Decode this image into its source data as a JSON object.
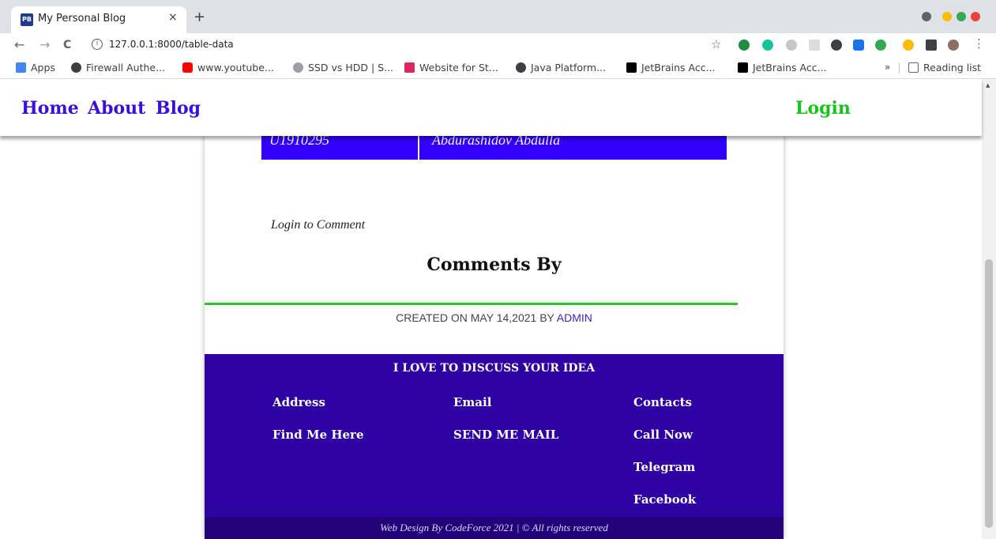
{
  "browser": {
    "tab_favicon": "PB",
    "tab_title": "My Personal Blog",
    "tab_close": "×",
    "new_tab": "+",
    "back": "←",
    "forward": "→",
    "reload": "C",
    "url": "127.0.0.1:8000/table-data",
    "star": "☆",
    "menu": "⋮",
    "bookmarks": [
      {
        "label": "Apps",
        "icon": "apps-grid-icon",
        "color": "#4285f4"
      },
      {
        "label": "Firewall Authe...",
        "icon": "globe-icon",
        "color": "#3c4043"
      },
      {
        "label": "www.youtube...",
        "icon": "youtube-icon",
        "color": "#ff0000"
      },
      {
        "label": "SSD vs HDD | S...",
        "icon": "site-icon",
        "color": "#9aa0a6"
      },
      {
        "label": "Website for St...",
        "icon": "w-logo-icon",
        "color": "#e0245e"
      },
      {
        "label": "Java Platform...",
        "icon": "globe-icon",
        "color": "#3c4043"
      },
      {
        "label": "JetBrains Acc...",
        "icon": "jetbrains-icon",
        "color": "#000000"
      },
      {
        "label": "JetBrains Acc...",
        "icon": "jetbrains-icon",
        "color": "#000000"
      }
    ],
    "bookmarks_overflow": "»",
    "reading_list": "Reading list"
  },
  "nav": {
    "home": "Home",
    "about": "About",
    "blog": "Blog",
    "login": "Login"
  },
  "table": {
    "id": "U1910295",
    "name": "Abdurashidov Abdulla"
  },
  "comments": {
    "login_prompt": "Login to Comment",
    "heading": "Comments By",
    "meta_prefix": "CREATED ON MAY 14,2021 BY",
    "meta_author": "ADMIN"
  },
  "footer": {
    "title": "I LOVE TO DISCUSS YOUR IDEA",
    "address_heading": "Address",
    "address_link": "Find Me Here",
    "email_heading": "Email",
    "email_link": "SEND ME MAIL",
    "contacts_heading": "Contacts",
    "contacts_links": [
      "Call Now",
      "Telegram",
      "Facebook"
    ],
    "credit": "Web Design By CodeForce 2021 | © All rights reserved"
  },
  "colors": {
    "nav_link": "#3a0ee0",
    "login": "#17c41a",
    "table_row": "#3300ff",
    "rule": "#22cc22",
    "footer_bg": "#2e02a3",
    "footer_bottom": "#22037a"
  }
}
